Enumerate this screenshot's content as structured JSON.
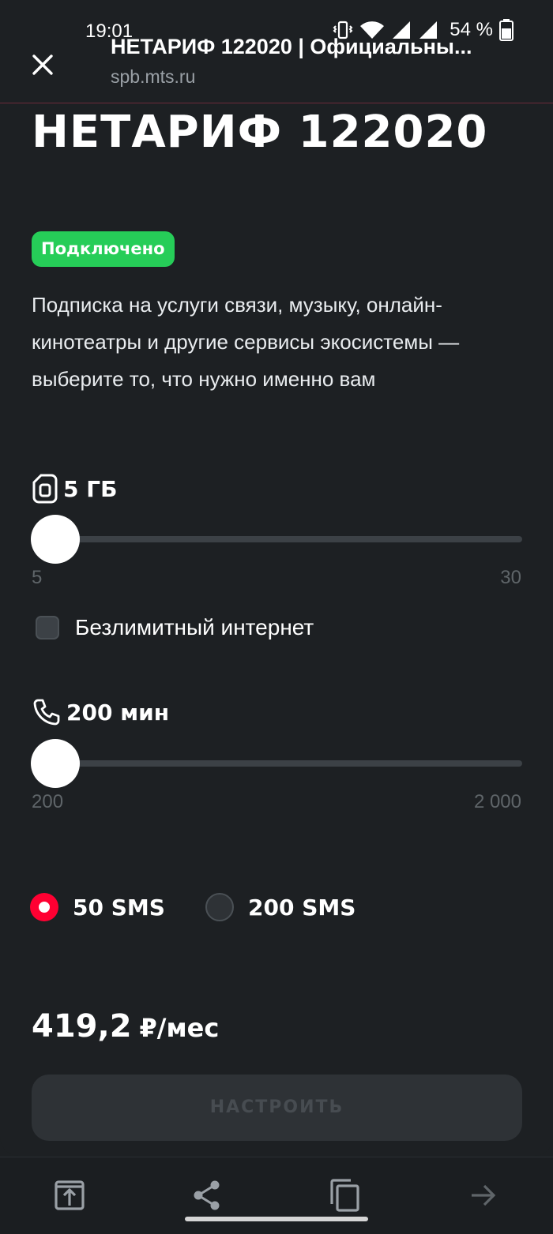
{
  "status_bar": {
    "time": "19:01",
    "battery_percent": "54 %",
    "icons": [
      "vibrate-icon",
      "wifi-icon",
      "signal-icon",
      "signal-icon",
      "battery-icon"
    ]
  },
  "browser": {
    "page_title": "НЕТАРИФ 122020 | Официальны...",
    "domain": "spb.mts.ru",
    "close_icon": "close-icon"
  },
  "tariff": {
    "title": "НЕТАРИФ 122020",
    "status_badge": "Подключено",
    "description": "Подписка на услуги связи, музыку, онлайн-кинотеатры и другие сервисы экосистемы — выберите то, что нужно именно вам"
  },
  "internet": {
    "label": "5 ГБ",
    "icon": "sim-card-icon",
    "slider_min": "5",
    "slider_max": "30",
    "slider_value": 5,
    "unlimited_checkbox_label": "Безлимитный интернет",
    "unlimited_checked": false
  },
  "minutes": {
    "label": "200 мин",
    "icon": "phone-icon",
    "slider_min": "200",
    "slider_max": "2 000",
    "slider_value": 200
  },
  "sms": {
    "options": [
      {
        "label": "50 SMS",
        "selected": true
      },
      {
        "label": "200 SMS",
        "selected": false
      }
    ]
  },
  "price": {
    "value": "419,2",
    "unit": "₽/мес"
  },
  "configure_button": "НАСТРОИТЬ",
  "toolbar": {
    "icons": [
      "open-in-app-icon",
      "share-icon",
      "copy-icon",
      "forward-arrow-icon"
    ]
  },
  "colors": {
    "background": "#1d2023",
    "badge_green": "#26cd58",
    "radio_red": "#ff0032",
    "slider_track": "#3c4146"
  }
}
